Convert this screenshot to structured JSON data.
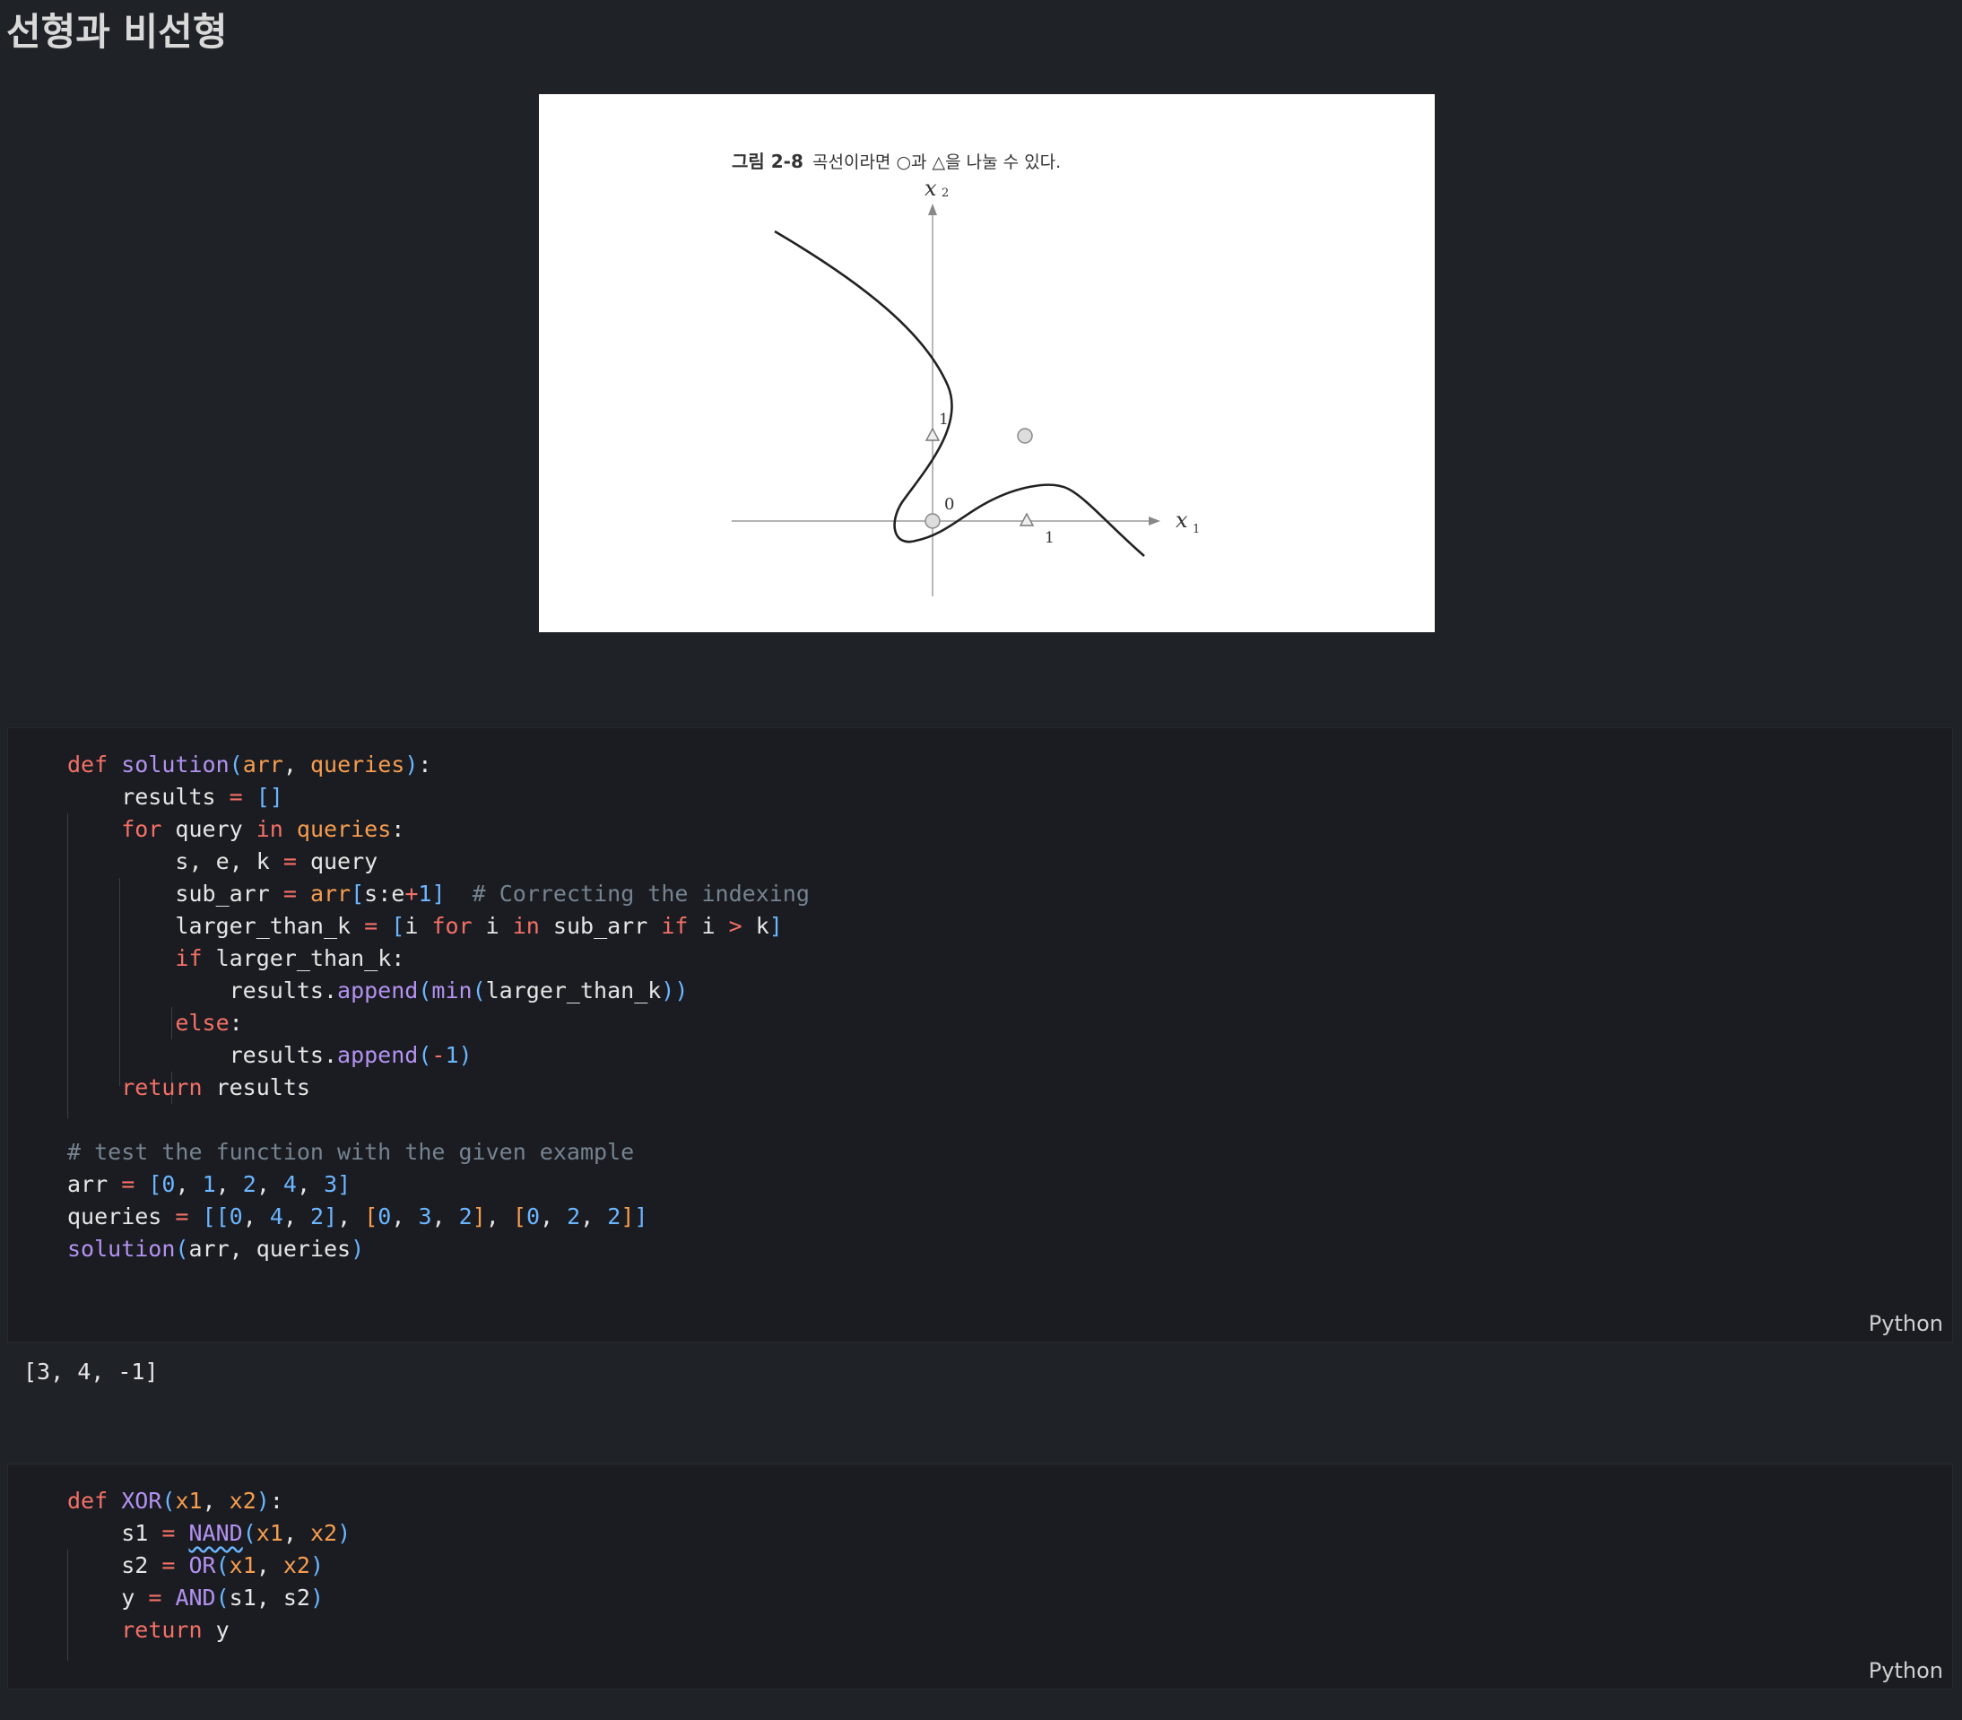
{
  "heading": "선형과 비선형",
  "figure": {
    "caption_num": "그림 2-8",
    "caption_text": "곡선이라면 ○과 △을 나눌 수 있다.",
    "x1_label": "x",
    "x1_sub": "1",
    "x2_label": "x",
    "x2_sub": "2",
    "origin_label": "0",
    "x_tick": "1",
    "y_tick": "1"
  },
  "cell1": {
    "language": "Python",
    "lines": [
      [
        [
          "kw",
          "def "
        ],
        [
          "fn",
          "solution"
        ],
        [
          "br",
          "("
        ],
        [
          "pa",
          "arr"
        ],
        [
          "tx",
          ", "
        ],
        [
          "pa",
          "queries"
        ],
        [
          "br",
          ")"
        ],
        [
          "tx",
          ":"
        ]
      ],
      [
        [
          "tx",
          "    results "
        ],
        [
          "op",
          "="
        ],
        [
          "tx",
          " "
        ],
        [
          "br",
          "[]"
        ]
      ],
      [
        [
          "tx",
          "    "
        ],
        [
          "kw",
          "for"
        ],
        [
          "tx",
          " query "
        ],
        [
          "kw",
          "in"
        ],
        [
          "tx",
          " "
        ],
        [
          "pa",
          "queries"
        ],
        [
          "tx",
          ":"
        ]
      ],
      [
        [
          "tx",
          "        s, e, k "
        ],
        [
          "op",
          "="
        ],
        [
          "tx",
          " query"
        ]
      ],
      [
        [
          "tx",
          "        sub_arr "
        ],
        [
          "op",
          "="
        ],
        [
          "tx",
          " "
        ],
        [
          "pa",
          "arr"
        ],
        [
          "br",
          "["
        ],
        [
          "tx",
          "s:e"
        ],
        [
          "op",
          "+"
        ],
        [
          "nu",
          "1"
        ],
        [
          "br",
          "]"
        ],
        [
          "tx",
          "  "
        ],
        [
          "cm",
          "# Correcting the indexing"
        ]
      ],
      [
        [
          "tx",
          "        larger_than_k "
        ],
        [
          "op",
          "="
        ],
        [
          "tx",
          " "
        ],
        [
          "br",
          "["
        ],
        [
          "tx",
          "i "
        ],
        [
          "kw",
          "for"
        ],
        [
          "tx",
          " i "
        ],
        [
          "kw",
          "in"
        ],
        [
          "tx",
          " sub_arr "
        ],
        [
          "kw",
          "if"
        ],
        [
          "tx",
          " i "
        ],
        [
          "op",
          ">"
        ],
        [
          "tx",
          " k"
        ],
        [
          "br",
          "]"
        ]
      ],
      [
        [
          "tx",
          "        "
        ],
        [
          "kw",
          "if"
        ],
        [
          "tx",
          " larger_than_k:"
        ]
      ],
      [
        [
          "tx",
          "            results."
        ],
        [
          "fn",
          "append"
        ],
        [
          "br",
          "("
        ],
        [
          "fn",
          "min"
        ],
        [
          "br",
          "("
        ],
        [
          "tx",
          "larger_than_k"
        ],
        [
          "br",
          "))"
        ]
      ],
      [
        [
          "tx",
          "        "
        ],
        [
          "kw",
          "else"
        ],
        [
          "tx",
          ":"
        ]
      ],
      [
        [
          "tx",
          "            results."
        ],
        [
          "fn",
          "append"
        ],
        [
          "br",
          "("
        ],
        [
          "op",
          "-"
        ],
        [
          "nu",
          "1"
        ],
        [
          "br",
          ")"
        ]
      ],
      [
        [
          "tx",
          "    "
        ],
        [
          "kw",
          "return"
        ],
        [
          "tx",
          " results"
        ]
      ],
      [
        [
          "tx",
          ""
        ]
      ],
      [
        [
          "cm",
          "# test the function with the given example"
        ]
      ],
      [
        [
          "tx",
          "arr "
        ],
        [
          "op",
          "="
        ],
        [
          "tx",
          " "
        ],
        [
          "br",
          "["
        ],
        [
          "nu",
          "0"
        ],
        [
          "tx",
          ", "
        ],
        [
          "nu",
          "1"
        ],
        [
          "tx",
          ", "
        ],
        [
          "nu",
          "2"
        ],
        [
          "tx",
          ", "
        ],
        [
          "nu",
          "4"
        ],
        [
          "tx",
          ", "
        ],
        [
          "nu",
          "3"
        ],
        [
          "br",
          "]"
        ]
      ],
      [
        [
          "tx",
          "queries "
        ],
        [
          "op",
          "="
        ],
        [
          "tx",
          " "
        ],
        [
          "br",
          "[["
        ],
        [
          "nu",
          "0"
        ],
        [
          "tx",
          ", "
        ],
        [
          "nu",
          "4"
        ],
        [
          "tx",
          ", "
        ],
        [
          "nu",
          "2"
        ],
        [
          "br",
          "]"
        ],
        [
          "tx",
          ", "
        ],
        [
          "pa",
          "["
        ],
        [
          "nu",
          "0"
        ],
        [
          "tx",
          ", "
        ],
        [
          "nu",
          "3"
        ],
        [
          "tx",
          ", "
        ],
        [
          "nu",
          "2"
        ],
        [
          "pa",
          "]"
        ],
        [
          "tx",
          ", "
        ],
        [
          "pa",
          "["
        ],
        [
          "nu",
          "0"
        ],
        [
          "tx",
          ", "
        ],
        [
          "nu",
          "2"
        ],
        [
          "tx",
          ", "
        ],
        [
          "nu",
          "2"
        ],
        [
          "pa",
          "]"
        ],
        [
          "br",
          "]"
        ]
      ],
      [
        [
          "fn",
          "solution"
        ],
        [
          "br",
          "("
        ],
        [
          "tx",
          "arr, queries"
        ],
        [
          "br",
          ")"
        ]
      ]
    ]
  },
  "output1": "[3, 4, -1]",
  "cell2": {
    "language": "Python",
    "lines": [
      [
        [
          "kw",
          "def "
        ],
        [
          "fn",
          "XOR"
        ],
        [
          "br",
          "("
        ],
        [
          "pa",
          "x1"
        ],
        [
          "tx",
          ", "
        ],
        [
          "pa",
          "x2"
        ],
        [
          "br",
          ")"
        ],
        [
          "tx",
          ":"
        ]
      ],
      [
        [
          "tx",
          "    s1 "
        ],
        [
          "op",
          "="
        ],
        [
          "tx",
          " "
        ],
        [
          "fn squig",
          "NAND"
        ],
        [
          "br",
          "("
        ],
        [
          "pa",
          "x1"
        ],
        [
          "tx",
          ", "
        ],
        [
          "pa",
          "x2"
        ],
        [
          "br",
          ")"
        ]
      ],
      [
        [
          "tx",
          "    s2 "
        ],
        [
          "op",
          "="
        ],
        [
          "tx",
          " "
        ],
        [
          "fn",
          "OR"
        ],
        [
          "br",
          "("
        ],
        [
          "pa",
          "x1"
        ],
        [
          "tx",
          ", "
        ],
        [
          "pa",
          "x2"
        ],
        [
          "br",
          ")"
        ]
      ],
      [
        [
          "tx",
          "    y "
        ],
        [
          "op",
          "="
        ],
        [
          "tx",
          " "
        ],
        [
          "fn",
          "AND"
        ],
        [
          "br",
          "("
        ],
        [
          "tx",
          "s1, s2"
        ],
        [
          "br",
          ")"
        ]
      ],
      [
        [
          "tx",
          "    "
        ],
        [
          "kw",
          "return"
        ],
        [
          "tx",
          " y"
        ]
      ]
    ]
  }
}
